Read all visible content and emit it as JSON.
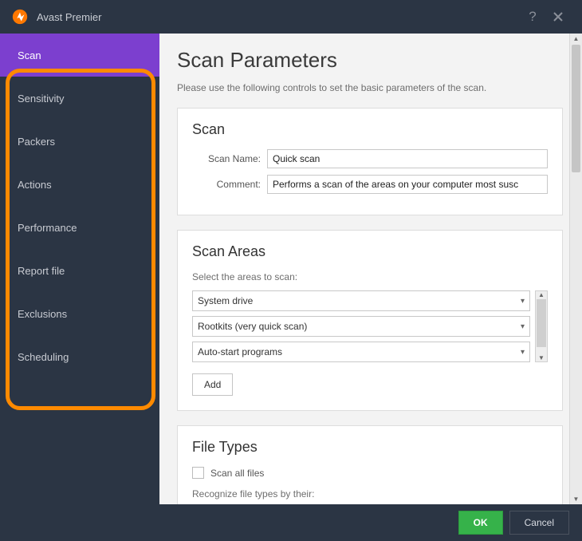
{
  "titlebar": {
    "app_name": "Avast Premier"
  },
  "sidebar": {
    "items": [
      {
        "label": "Scan",
        "active": true
      },
      {
        "label": "Sensitivity",
        "active": false
      },
      {
        "label": "Packers",
        "active": false
      },
      {
        "label": "Actions",
        "active": false
      },
      {
        "label": "Performance",
        "active": false
      },
      {
        "label": "Report file",
        "active": false
      },
      {
        "label": "Exclusions",
        "active": false
      },
      {
        "label": "Scheduling",
        "active": false
      }
    ]
  },
  "content": {
    "title": "Scan Parameters",
    "subtitle": "Please use the following controls to set the basic parameters of the scan.",
    "scan_panel": {
      "heading": "Scan",
      "name_label": "Scan Name:",
      "name_value": "Quick scan",
      "comment_label": "Comment:",
      "comment_value": "Performs a scan of the areas on your computer most susc"
    },
    "areas_panel": {
      "heading": "Scan Areas",
      "hint": "Select the areas to scan:",
      "items": [
        "System drive",
        "Rootkits (very quick scan)",
        "Auto-start programs"
      ],
      "add_label": "Add"
    },
    "filetypes_panel": {
      "heading": "File Types",
      "scan_all_label": "Scan all files",
      "scan_all_checked": false,
      "hint": "Recognize file types by their:"
    }
  },
  "footer": {
    "ok_label": "OK",
    "cancel_label": "Cancel"
  }
}
